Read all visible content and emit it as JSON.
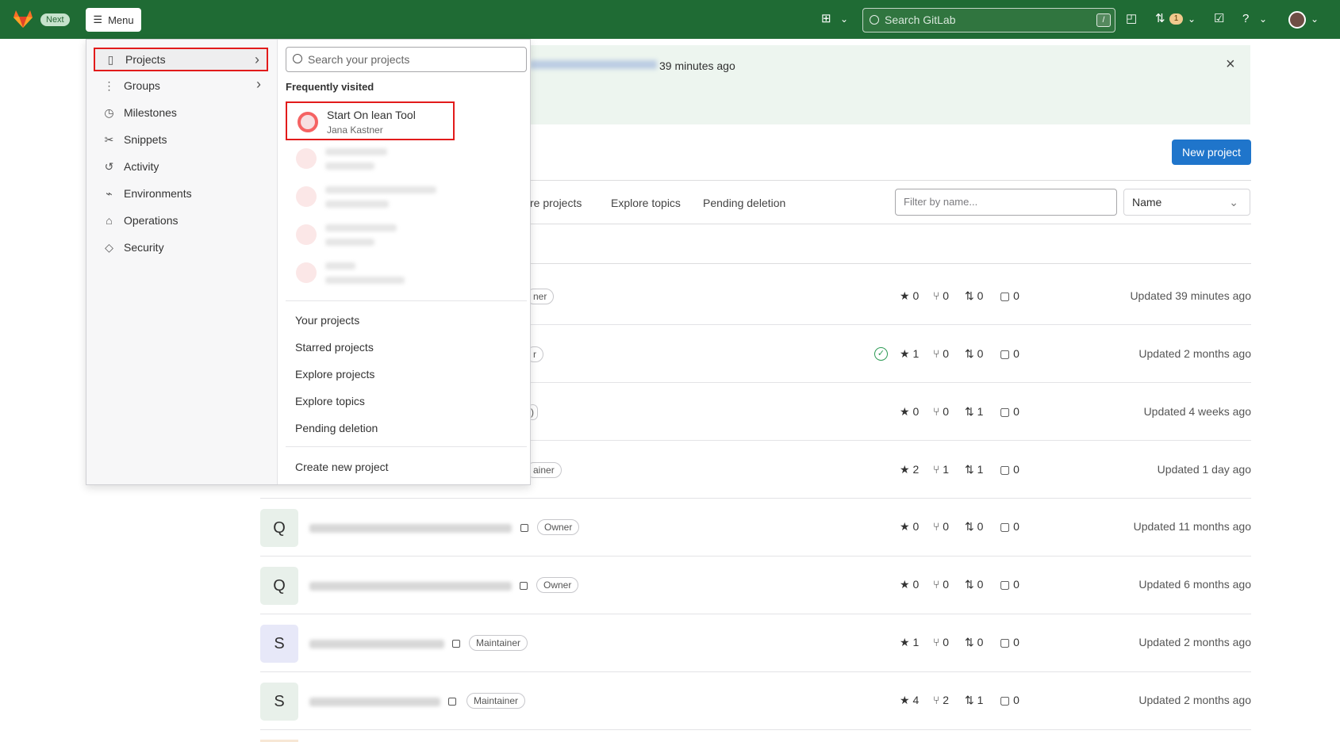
{
  "topbar": {
    "next_label": "Next",
    "menu_label": "Menu",
    "search_placeholder": "Search GitLab",
    "search_shortcut": "/",
    "merge_requests_count": "1",
    "icons": {
      "create": "create-icon",
      "issues": "issues-icon",
      "merge_requests": "merge-request-icon",
      "todos": "todo-icon",
      "help": "help-icon",
      "user": "user-avatar"
    }
  },
  "banner": {
    "text": "39 minutes ago"
  },
  "header": {
    "new_project_label": "New project"
  },
  "tabs": {
    "explore_projects_partial": "re projects",
    "explore_topics": "Explore topics",
    "pending_deletion": "Pending deletion"
  },
  "filters": {
    "filter_placeholder": "Filter by name...",
    "sort_value": "Name",
    "sort_chevron": "⌄"
  },
  "projects": {
    "rows": [
      {
        "avatar": "",
        "role": "ner",
        "stars": "0",
        "forks": "0",
        "merge_requests": "0",
        "issues": "0",
        "updated": "Updated 39 minutes ago"
      },
      {
        "avatar": "",
        "role": "r",
        "stars": "1",
        "forks": "0",
        "merge_requests": "0",
        "issues": "0",
        "updated": "Updated 2 months ago"
      },
      {
        "avatar": "",
        "role": ")",
        "stars": "0",
        "forks": "0",
        "merge_requests": "1",
        "issues": "0",
        "updated": "Updated 4 weeks ago"
      },
      {
        "avatar": "",
        "role": "ainer",
        "stars": "2",
        "forks": "1",
        "merge_requests": "1",
        "issues": "0",
        "updated": "Updated 1 day ago"
      },
      {
        "avatar": "Q",
        "role": "Owner",
        "stars": "0",
        "forks": "0",
        "merge_requests": "0",
        "issues": "0",
        "updated": "Updated 11 months ago"
      },
      {
        "avatar": "Q",
        "role": "Owner",
        "stars": "0",
        "forks": "0",
        "merge_requests": "0",
        "issues": "0",
        "updated": "Updated 6 months ago"
      },
      {
        "avatar": "S",
        "role": "Maintainer",
        "stars": "1",
        "forks": "0",
        "merge_requests": "0",
        "issues": "0",
        "updated": "Updated 2 months ago"
      },
      {
        "avatar": "S",
        "role": "Maintainer",
        "stars": "4",
        "forks": "2",
        "merge_requests": "1",
        "issues": "0",
        "updated": "Updated 2 months ago"
      }
    ]
  },
  "dropdown": {
    "nav": [
      {
        "label": "Projects",
        "icon": "project-icon",
        "selected": true
      },
      {
        "label": "Groups",
        "icon": "groups-icon"
      },
      {
        "label": "Milestones",
        "icon": "milestone-icon"
      },
      {
        "label": "Snippets",
        "icon": "snippet-icon"
      },
      {
        "label": "Activity",
        "icon": "activity-icon"
      },
      {
        "label": "Environments",
        "icon": "environment-icon"
      },
      {
        "label": "Operations",
        "icon": "operations-icon"
      },
      {
        "label": "Security",
        "icon": "security-icon"
      }
    ],
    "search_placeholder": "Search your projects",
    "section_title": "Frequently visited",
    "frequent": [
      {
        "title": "Start On lean Tool",
        "subtitle": "Jana Kastner"
      }
    ],
    "links": [
      "Your projects",
      "Starred projects",
      "Explore projects",
      "Explore topics",
      "Pending deletion",
      "Create new project"
    ]
  },
  "colors": {
    "topbar": "#1f6b34",
    "primary_button": "#1f75cb",
    "selection_outline": "#e21b1b"
  }
}
